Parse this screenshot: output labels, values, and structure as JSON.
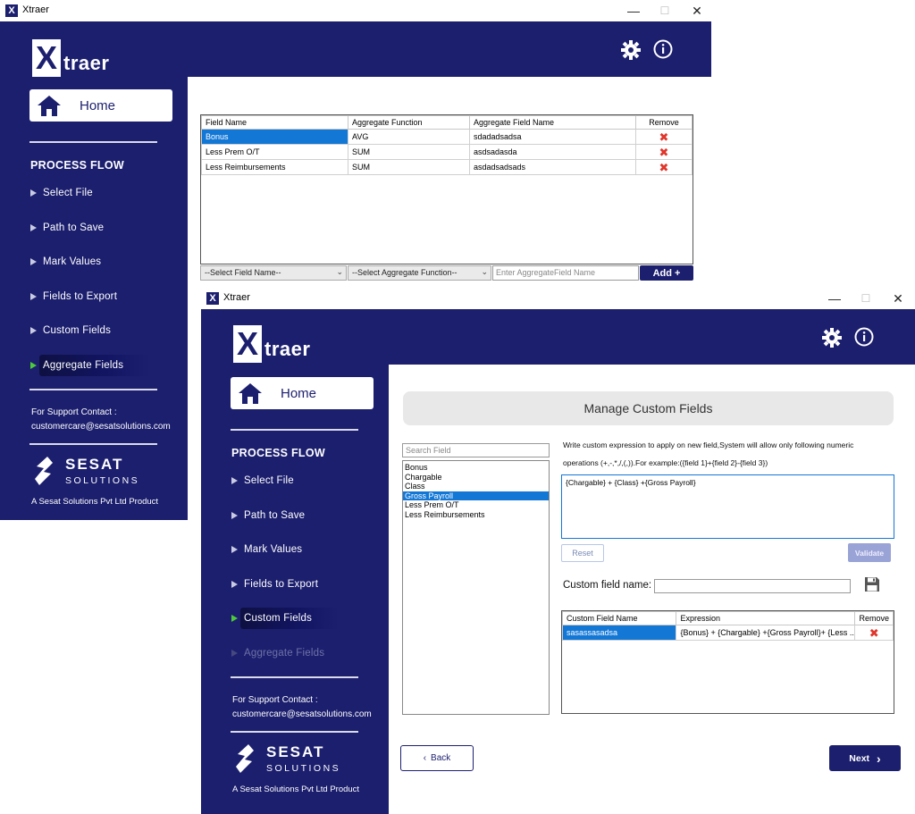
{
  "window1": {
    "title": "Xtraer",
    "logo_x": "X",
    "logo_rest": "traer",
    "home_label": "Home",
    "process_flow_heading": "PROCESS FLOW",
    "nav": [
      "Select File",
      "Path to Save",
      "Mark Values",
      "Fields to Export",
      "Custom Fields",
      "Aggregate Fields"
    ],
    "active_nav": "Aggregate Fields",
    "support_label": "For Support Contact :",
    "support_email": "customercare@sesatsolutions.com",
    "brand_name": "SESAT",
    "brand_sub": "SOLUTIONS",
    "tagline": "A Sesat Solutions Pvt Ltd Product",
    "grid": {
      "headers": [
        "Field Name",
        "Aggregate Function",
        "Aggregate Field Name",
        "Remove"
      ],
      "rows": [
        [
          "Bonus",
          "AVG",
          "sdadadsadsa"
        ],
        [
          "Less Prem O/T",
          "SUM",
          "asdsadasda"
        ],
        [
          "Less Reimbursements",
          "SUM",
          "asdadsadsads"
        ]
      ],
      "remove_glyph": "✖"
    },
    "field_select": "--Select Field Name--",
    "func_select": "--Select Aggregate Function--",
    "agg_name_placeholder": "Enter AggregateField Name",
    "add_label": "Add  +"
  },
  "window2": {
    "title": "Xtraer",
    "logo_x": "X",
    "logo_rest": "traer",
    "home_label": "Home",
    "process_flow_heading": "PROCESS FLOW",
    "nav": [
      "Select File",
      "Path to Save",
      "Mark Values",
      "Fields to Export",
      "Custom Fields",
      "Aggregate Fields"
    ],
    "active_nav": "Custom Fields",
    "disabled_nav": "Aggregate Fields",
    "support_label": "For Support Contact :",
    "support_email": "customercare@sesatsolutions.com",
    "brand_name": "SESAT",
    "brand_sub": "SOLUTIONS",
    "tagline": "A Sesat Solutions Pvt Ltd Product",
    "panel_title": "Manage Custom Fields",
    "search_placeholder": "Search Field",
    "fields": [
      "Bonus",
      "Chargable",
      "Class",
      "Gross Payroll",
      "Less Prem O/T",
      "Less Reimbursements"
    ],
    "selected_field": "Gross Payroll",
    "instructions_line1": "Write custom expression to apply on new field,System will allow only following numeric",
    "instructions_line2": "operations (+,-,*,/,(,)).For example:({field 1}+{field 2}-{field 3})",
    "expression": "{Chargable} + {Class}  +{Gross Payroll}",
    "reset_label": "Reset",
    "validate_label": "Validate",
    "custom_field_name_label": "Custom field name:",
    "custom_field_name_value": "",
    "grid": {
      "headers": [
        "Custom Field Name",
        "Expression",
        "Remove"
      ],
      "rows": [
        [
          "sasassasadsa",
          "{Bonus} + {Chargable}  +{Gross Payroll}+  {Less ..."
        ]
      ],
      "remove_glyph": "✖"
    },
    "back_label": "Back",
    "next_label": "Next"
  },
  "colors": {
    "navy": "#1c1f6e",
    "selection": "#1377d6",
    "remove_red": "#e0362b",
    "active_marker": "#4ccb3a"
  },
  "icons": [
    "settings-gear-icon",
    "info-icon",
    "home-icon",
    "save-disk-icon",
    "remove-x-icon",
    "chevron-left-icon",
    "chevron-right-icon"
  ]
}
